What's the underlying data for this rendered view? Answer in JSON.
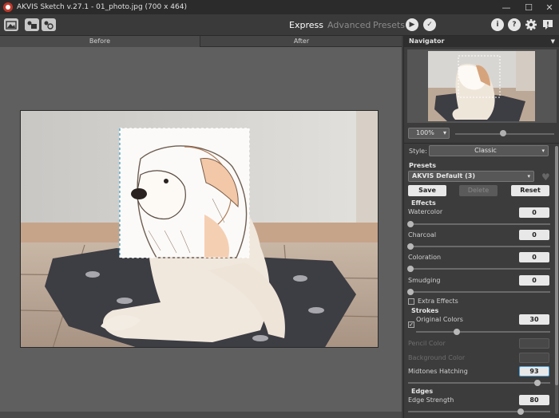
{
  "window": {
    "title": "AKVIS Sketch v.27.1 - 01_photo.jpg (700 x 464)",
    "minimize": "—",
    "maximize": "☐",
    "close": "✕"
  },
  "toolbar": {
    "modes": [
      "Express",
      "Advanced",
      "Presets"
    ],
    "active_mode": "Express",
    "run_icon": "▶",
    "apply_icon": "✓",
    "info_icon": "i",
    "help_icon": "?"
  },
  "view_tabs": {
    "before": "Before",
    "after": "After"
  },
  "navigator": {
    "title": "Navigator",
    "collapse": "▼",
    "zoom": "100%",
    "zoom_arrow": "▾",
    "zoom_level": 0.5
  },
  "settings": {
    "style_label": "Style:",
    "style_value": "Classic",
    "presets_label": "Presets",
    "preset_value": "AKVIS Default (3)",
    "save": "Save",
    "delete": "Delete",
    "reset": "Reset",
    "heart_icon": "♥",
    "effects_label": "Effects",
    "watercolor": {
      "label": "Watercolor",
      "value": "0"
    },
    "charcoal": {
      "label": "Charcoal",
      "value": "0"
    },
    "coloration": {
      "label": "Coloration",
      "value": "0"
    },
    "smudging": {
      "label": "Smudging",
      "value": "0"
    },
    "extra_effects": "Extra Effects",
    "strokes_label": "Strokes",
    "original_colors": {
      "label": "Original Colors",
      "value": "30",
      "checked": "✓"
    },
    "pencil_color": "Pencil Color",
    "background_color": "Background Color",
    "midtones_hatching": {
      "label": "Midtones Hatching",
      "value": "93"
    },
    "edges_label": "Edges",
    "edge_strength": {
      "label": "Edge Strength",
      "value": "80"
    },
    "arrow": "▾"
  }
}
